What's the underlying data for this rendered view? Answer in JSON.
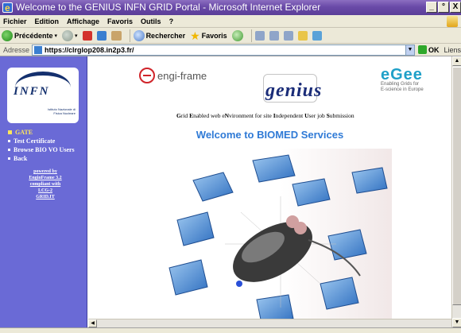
{
  "window": {
    "title": "Welcome to the GENIUS INFN GRID Portal - Microsoft Internet Explorer",
    "controls": [
      "_",
      "°",
      "X"
    ]
  },
  "menu": [
    "Fichier",
    "Edition",
    "Affichage",
    "Favoris",
    "Outils",
    "?"
  ],
  "toolbar": {
    "back_label": "Précédente",
    "search_label": "Rechercher",
    "favorites_label": "Favoris"
  },
  "address": {
    "label": "Adresse",
    "url": "https://clrglop208.in2p3.fr/",
    "go_label": "OK",
    "links_label": "Liens"
  },
  "sidebar": {
    "nav": [
      {
        "label": "GATE",
        "active": true
      },
      {
        "label": "Test Certificate",
        "active": false
      },
      {
        "label": "Browse BIO VO Users",
        "active": false
      },
      {
        "label": "Back",
        "active": false
      }
    ],
    "powered": [
      "powered by",
      "EnginFrame 3.2",
      "compliant with",
      "LCG-2",
      "GRID.IT"
    ],
    "infn_logo": {
      "word": "INFN",
      "sub": "Istituto Nazionale di Fisica Nucleare"
    }
  },
  "main": {
    "enginframe_logo": "engi-frame",
    "genius_logo": "genius",
    "egee_logo": {
      "word": "eGee",
      "line1": "Enabling Grids for",
      "line2": "E-science in Europe"
    },
    "tagline": "Grid Enabled web eNvironment for site Independent User job Submission",
    "welcome": "Welcome to BIOMED Services"
  },
  "colors": {
    "title_bar": "#6a4aa8",
    "sidebar": "#6a6ad6",
    "welcome": "#2f7ad6",
    "cubes": "#4f8ed6"
  }
}
